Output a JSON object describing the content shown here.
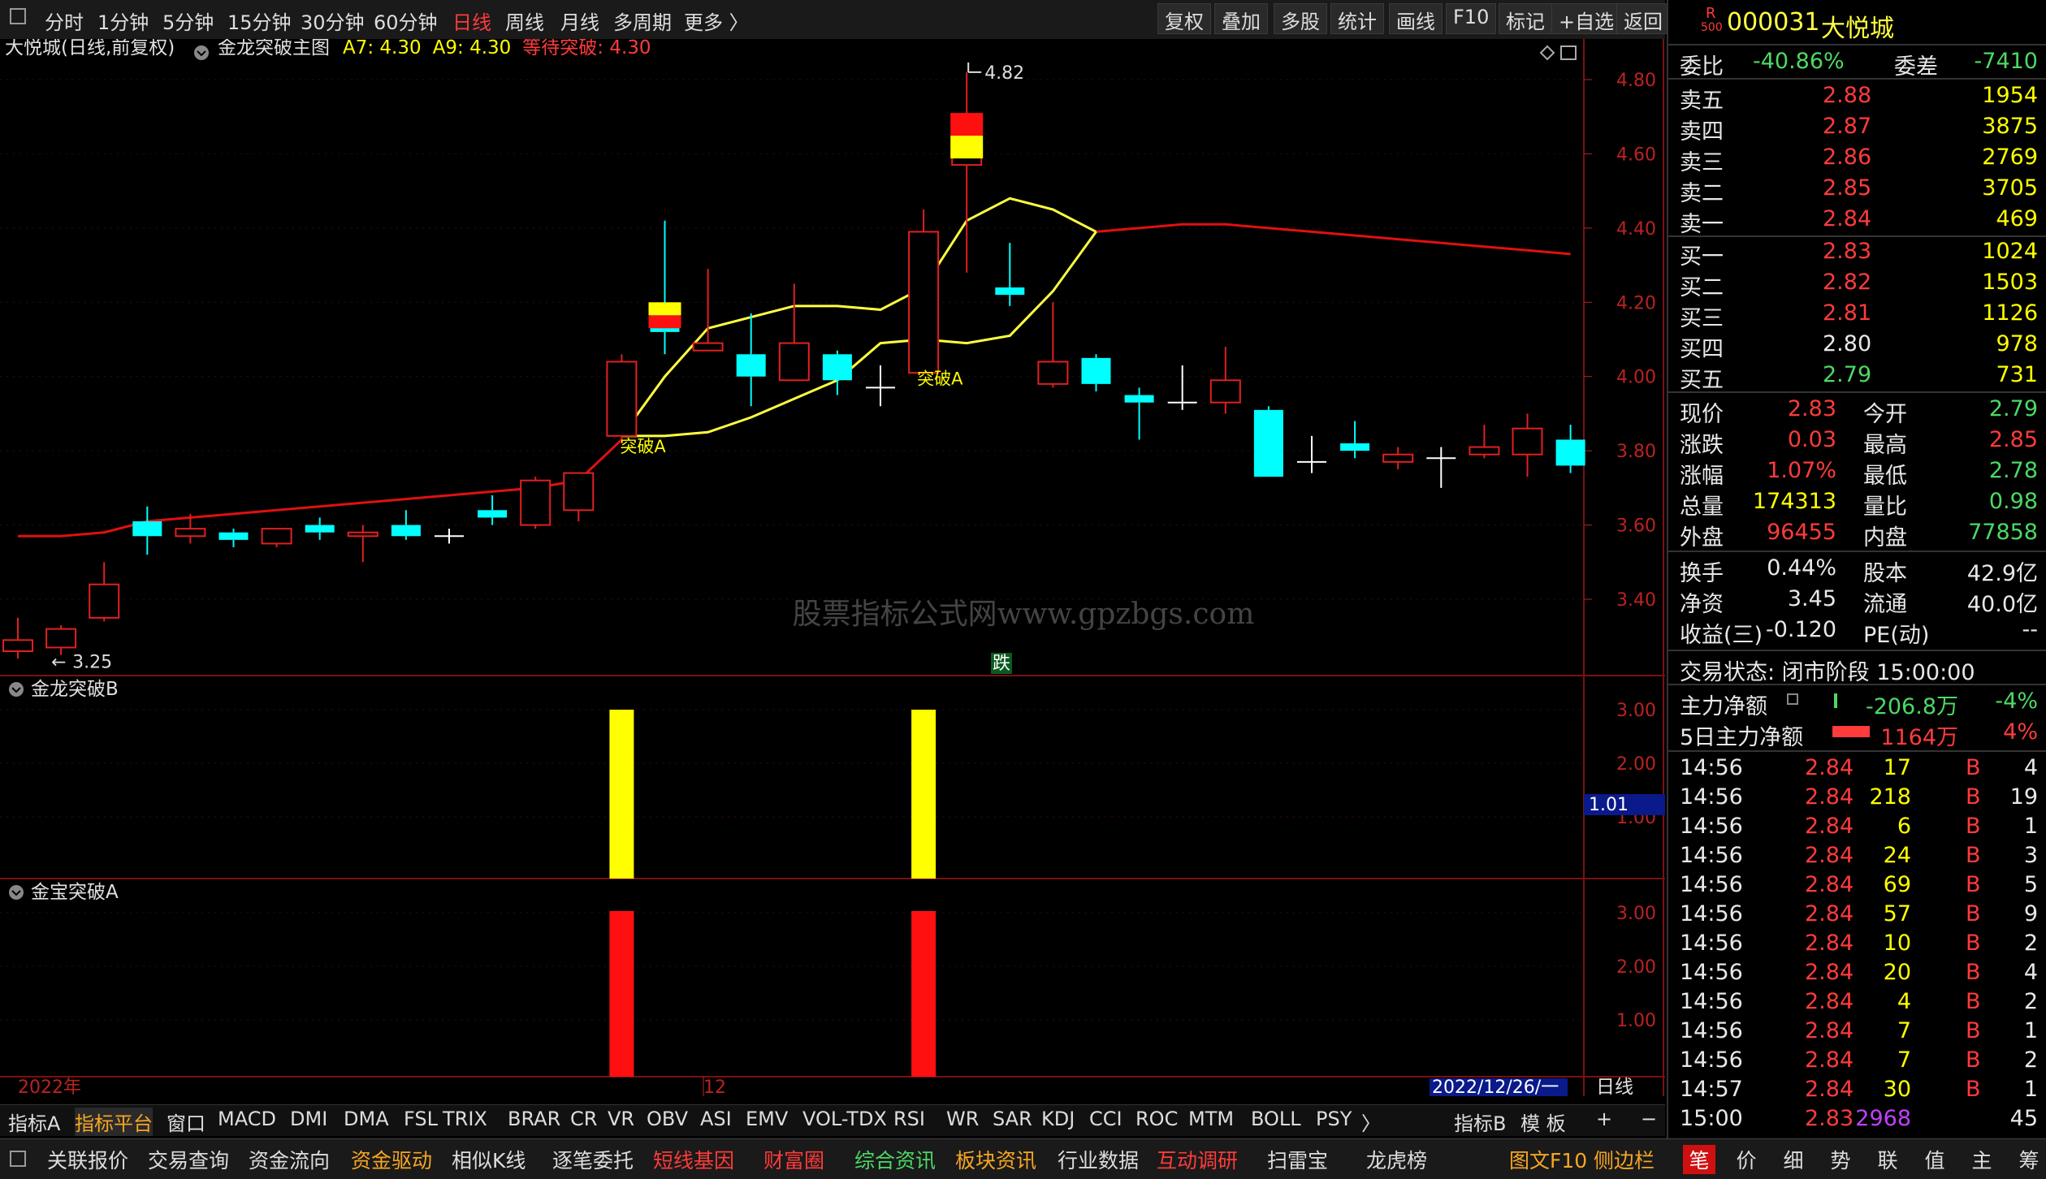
{
  "toolbar": {
    "periods": [
      "分时",
      "1分钟",
      "5分钟",
      "15分钟",
      "30分钟",
      "60分钟",
      "日线",
      "周线",
      "月线",
      "多周期",
      "更多 〉"
    ],
    "active_period": "日线",
    "buttons": [
      "复权",
      "叠加",
      "多股",
      "统计",
      "画线",
      "F10",
      "标记",
      "+自选",
      "返回"
    ]
  },
  "chart_header": {
    "stock": "大悦城(日线,前复权)",
    "indicator": "金龙突破主图",
    "a7": "A7: 4.30",
    "a9": "A9: 4.30",
    "wait": "等待突破: 4.30",
    "watermark": "股票指标公式网www.gpzbgs.com"
  },
  "chart_data": {
    "type": "candlestick",
    "y_ticks": [
      "4.80",
      "4.60",
      "4.40",
      "4.20",
      "4.00",
      "3.80",
      "3.60",
      "3.40"
    ],
    "ylim": [
      3.22,
      4.88
    ],
    "x_labels": [
      "2022年",
      "12",
      "2022/12/26/一"
    ],
    "high_label": "4.82",
    "low_label": "3.25",
    "candles": [
      {
        "o": 3.26,
        "h": 3.35,
        "l": 3.24,
        "c": 3.29,
        "up": true
      },
      {
        "o": 3.27,
        "h": 3.33,
        "l": 3.25,
        "c": 3.32,
        "up": true
      },
      {
        "o": 3.35,
        "h": 3.5,
        "l": 3.34,
        "c": 3.44,
        "up": true
      },
      {
        "o": 3.61,
        "h": 3.65,
        "l": 3.52,
        "c": 3.57,
        "up": false
      },
      {
        "o": 3.57,
        "h": 3.63,
        "l": 3.55,
        "c": 3.59,
        "up": true
      },
      {
        "o": 3.58,
        "h": 3.59,
        "l": 3.54,
        "c": 3.56,
        "up": false
      },
      {
        "o": 3.55,
        "h": 3.59,
        "l": 3.54,
        "c": 3.59,
        "up": true
      },
      {
        "o": 3.6,
        "h": 3.62,
        "l": 3.56,
        "c": 3.58,
        "up": false
      },
      {
        "o": 3.57,
        "h": 3.6,
        "l": 3.5,
        "c": 3.58,
        "up": true
      },
      {
        "o": 3.6,
        "h": 3.64,
        "l": 3.56,
        "c": 3.57,
        "up": false
      },
      {
        "o": 3.57,
        "h": 3.59,
        "l": 3.55,
        "c": 3.57,
        "up": false
      },
      {
        "o": 3.62,
        "h": 3.68,
        "l": 3.6,
        "c": 3.64,
        "up": false
      },
      {
        "o": 3.6,
        "h": 3.73,
        "l": 3.59,
        "c": 3.72,
        "up": true
      },
      {
        "o": 3.64,
        "h": 3.74,
        "l": 3.61,
        "c": 3.74,
        "up": true
      },
      {
        "o": 3.84,
        "h": 4.06,
        "l": 3.82,
        "c": 4.04,
        "up": true
      },
      {
        "o": 4.12,
        "h": 4.42,
        "l": 4.06,
        "c": 4.19,
        "up": false
      },
      {
        "o": 4.07,
        "h": 4.29,
        "l": 4.07,
        "c": 4.09,
        "up": true
      },
      {
        "o": 4.06,
        "h": 4.17,
        "l": 3.92,
        "c": 4.0,
        "up": false
      },
      {
        "o": 3.99,
        "h": 4.25,
        "l": 3.99,
        "c": 4.09,
        "up": true
      },
      {
        "o": 4.06,
        "h": 4.07,
        "l": 3.95,
        "c": 3.99,
        "up": false
      },
      {
        "o": 3.97,
        "h": 4.03,
        "l": 3.92,
        "c": 3.97,
        "up": true
      },
      {
        "o": 4.01,
        "h": 4.45,
        "l": 4.01,
        "c": 4.39,
        "up": true
      },
      {
        "o": 4.57,
        "h": 4.82,
        "l": 4.28,
        "c": 4.65,
        "up": true
      },
      {
        "o": 4.22,
        "h": 4.36,
        "l": 4.19,
        "c": 4.24,
        "up": false
      },
      {
        "o": 3.98,
        "h": 4.2,
        "l": 3.97,
        "c": 4.04,
        "up": true
      },
      {
        "o": 4.05,
        "h": 4.06,
        "l": 3.96,
        "c": 3.98,
        "up": false
      },
      {
        "o": 3.95,
        "h": 3.97,
        "l": 3.83,
        "c": 3.93,
        "up": false
      },
      {
        "o": 3.93,
        "h": 4.03,
        "l": 3.91,
        "c": 3.93,
        "up": false
      },
      {
        "o": 3.93,
        "h": 4.08,
        "l": 3.9,
        "c": 3.99,
        "up": true
      },
      {
        "o": 3.91,
        "h": 3.92,
        "l": 3.73,
        "c": 3.73,
        "up": false
      },
      {
        "o": 3.77,
        "h": 3.84,
        "l": 3.74,
        "c": 3.77,
        "up": false
      },
      {
        "o": 3.82,
        "h": 3.88,
        "l": 3.78,
        "c": 3.8,
        "up": false
      },
      {
        "o": 3.77,
        "h": 3.81,
        "l": 3.75,
        "c": 3.79,
        "up": true
      },
      {
        "o": 3.78,
        "h": 3.81,
        "l": 3.7,
        "c": 3.78,
        "up": false
      },
      {
        "o": 3.79,
        "h": 3.87,
        "l": 3.78,
        "c": 3.81,
        "up": true
      },
      {
        "o": 3.79,
        "h": 3.9,
        "l": 3.73,
        "c": 3.86,
        "up": true
      },
      {
        "o": 3.83,
        "h": 3.87,
        "l": 3.74,
        "c": 3.76,
        "up": false
      }
    ],
    "red_line": [
      3.57,
      3.57,
      3.58,
      3.61,
      3.62,
      3.63,
      3.64,
      3.65,
      3.66,
      3.67,
      3.68,
      3.69,
      3.7,
      3.72,
      3.83,
      null,
      null,
      null,
      null,
      null,
      null,
      null,
      null,
      null,
      null,
      4.39,
      4.4,
      4.41,
      4.41,
      4.4,
      4.39,
      4.38,
      4.37,
      4.36,
      4.35,
      4.34,
      4.33
    ],
    "yellow_upper": [
      null,
      null,
      null,
      null,
      null,
      null,
      null,
      null,
      null,
      null,
      null,
      null,
      null,
      null,
      3.84,
      4.0,
      4.13,
      4.16,
      4.19,
      4.19,
      4.18,
      4.24,
      4.42,
      4.48,
      4.45,
      4.39
    ],
    "yellow_lower": [
      null,
      null,
      null,
      null,
      null,
      null,
      null,
      null,
      null,
      null,
      null,
      null,
      null,
      null,
      3.84,
      3.84,
      3.85,
      3.89,
      3.94,
      3.99,
      4.09,
      4.1,
      4.09,
      4.11,
      4.23,
      4.39
    ],
    "breakthrough_labels": [
      "突破A",
      "突破A"
    ],
    "fall_label": "跌",
    "sub1": {
      "name": "金龙突破B",
      "ticks": [
        "3.00",
        "2.00",
        "1.00"
      ],
      "value_label": "1.01",
      "bars": [
        14,
        21
      ]
    },
    "sub2": {
      "name": "金宝突破A",
      "ticks": [
        "3.00",
        "2.00",
        "1.00"
      ],
      "bars": [
        14,
        21
      ]
    },
    "period_label": "日线"
  },
  "index_tabs": [
    "指标A",
    "指标平台",
    "窗口",
    "MACD",
    "DMI",
    "DMA",
    "FSL",
    "TRIX",
    "BRAR",
    "CR",
    "VR",
    "OBV",
    "ASI",
    "EMV",
    "VOL-TDX",
    "RSI",
    "WR",
    "SAR",
    "KDJ",
    "CCI",
    "ROC",
    "MTM",
    "BOLL",
    "PSY",
    "〉"
  ],
  "index_right": [
    "指标B",
    "模 板",
    "+",
    "−"
  ],
  "func_bar": [
    "关联报价",
    "交易查询",
    "资金流向",
    "资金驱动",
    "相似K线",
    "逐笔委托",
    "短线基因",
    "财富圈",
    "综合资讯",
    "板块资讯",
    "行业数据",
    "互动调研",
    "扫雷宝",
    "龙虎榜",
    "图文F10",
    "侧边栏"
  ],
  "panel": {
    "badge_top": "R",
    "badge_bottom": "500",
    "code": "000031",
    "name": "大悦城",
    "weibi_label": "委比",
    "weibi": "-40.86%",
    "weicha_label": "委差",
    "weicha": "-7410",
    "asks": [
      {
        "label": "卖五",
        "price": "2.88",
        "vol": "1954"
      },
      {
        "label": "卖四",
        "price": "2.87",
        "vol": "3875"
      },
      {
        "label": "卖三",
        "price": "2.86",
        "vol": "2769"
      },
      {
        "label": "卖二",
        "price": "2.85",
        "vol": "3705"
      },
      {
        "label": "卖一",
        "price": "2.84",
        "vol": "469"
      }
    ],
    "bids": [
      {
        "label": "买一",
        "price": "2.83",
        "vol": "1024"
      },
      {
        "label": "买二",
        "price": "2.82",
        "vol": "1503"
      },
      {
        "label": "买三",
        "price": "2.81",
        "vol": "1126"
      },
      {
        "label": "买四",
        "price": "2.80",
        "vol": "978"
      },
      {
        "label": "买五",
        "price": "2.79",
        "vol": "731"
      }
    ],
    "stats": [
      {
        "l1": "现价",
        "v1": "2.83",
        "c1": "red",
        "l2": "今开",
        "v2": "2.79",
        "c2": "green"
      },
      {
        "l1": "涨跌",
        "v1": "0.03",
        "c1": "red",
        "l2": "最高",
        "v2": "2.85",
        "c2": "red"
      },
      {
        "l1": "涨幅",
        "v1": "1.07%",
        "c1": "red",
        "l2": "最低",
        "v2": "2.78",
        "c2": "green"
      },
      {
        "l1": "总量",
        "v1": "174313",
        "c1": "yellow",
        "l2": "量比",
        "v2": "0.98",
        "c2": "green"
      },
      {
        "l1": "外盘",
        "v1": "96455",
        "c1": "red",
        "l2": "内盘",
        "v2": "77858",
        "c2": "green"
      }
    ],
    "stats2": [
      {
        "l1": "换手",
        "v1": "0.44%",
        "l2": "股本",
        "v2": "42.9亿"
      },
      {
        "l1": "净资",
        "v1": "3.45",
        "l2": "流通",
        "v2": "40.0亿"
      },
      {
        "l1": "收益(三)",
        "v1": "-0.120",
        "l2": "PE(动)",
        "v2": "--"
      }
    ],
    "trade_status": "交易状态: 闭市阶段 15:00:00",
    "main_net_label": "主力净额",
    "main_net": "-206.8万",
    "main_net_pct": "-4%",
    "main5_label": "5日主力净额",
    "main5": "1164万",
    "main5_pct": "4%",
    "ticks": [
      {
        "t": "14:56",
        "p": "2.84",
        "v": "17",
        "b": "B",
        "n": "4"
      },
      {
        "t": "14:56",
        "p": "2.84",
        "v": "218",
        "b": "B",
        "n": "19"
      },
      {
        "t": "14:56",
        "p": "2.84",
        "v": "6",
        "b": "B",
        "n": "1"
      },
      {
        "t": "14:56",
        "p": "2.84",
        "v": "24",
        "b": "B",
        "n": "3"
      },
      {
        "t": "14:56",
        "p": "2.84",
        "v": "69",
        "b": "B",
        "n": "5"
      },
      {
        "t": "14:56",
        "p": "2.84",
        "v": "57",
        "b": "B",
        "n": "9"
      },
      {
        "t": "14:56",
        "p": "2.84",
        "v": "10",
        "b": "B",
        "n": "2"
      },
      {
        "t": "14:56",
        "p": "2.84",
        "v": "20",
        "b": "B",
        "n": "4"
      },
      {
        "t": "14:56",
        "p": "2.84",
        "v": "4",
        "b": "B",
        "n": "2"
      },
      {
        "t": "14:56",
        "p": "2.84",
        "v": "7",
        "b": "B",
        "n": "1"
      },
      {
        "t": "14:56",
        "p": "2.84",
        "v": "7",
        "b": "B",
        "n": "2"
      },
      {
        "t": "14:57",
        "p": "2.84",
        "v": "30",
        "b": "B",
        "n": "1"
      },
      {
        "t": "15:00",
        "p": "2.83",
        "v": "2968",
        "b": "",
        "n": "45"
      }
    ],
    "bottom_tabs": [
      "笔",
      "价",
      "细",
      "势",
      "联",
      "值",
      "主",
      "筹"
    ]
  }
}
